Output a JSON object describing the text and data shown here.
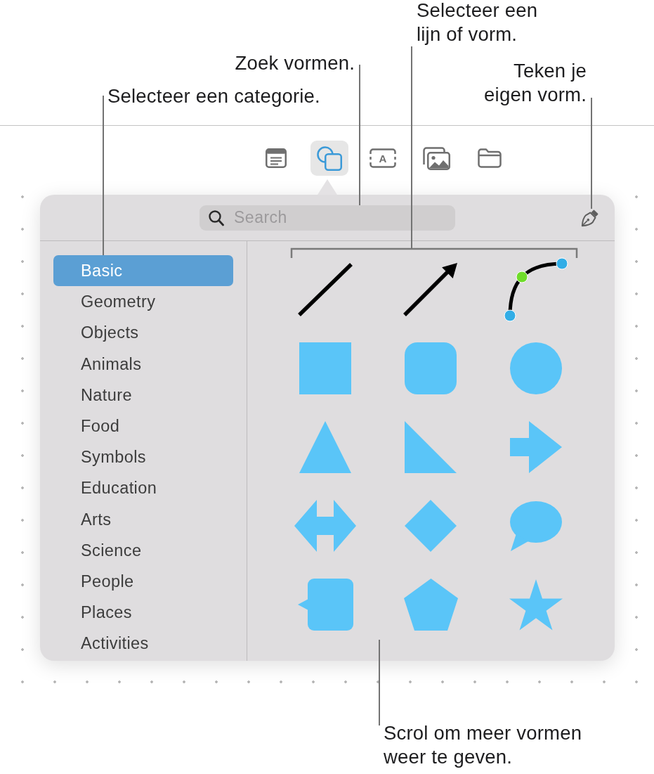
{
  "callouts": [
    {
      "text": "Selecteer een lijn of vorm."
    },
    {
      "text": "Zoek vormen."
    },
    {
      "text": "Selecteer een categorie."
    },
    {
      "text": "Teken je eigen vorm."
    },
    {
      "text": "Scrol om meer vormen weer te geven."
    }
  ],
  "toolbar": {
    "items": [
      {
        "kind": "notes",
        "selected": false
      },
      {
        "kind": "shapes",
        "selected": true
      },
      {
        "kind": "textbox",
        "label": "A",
        "selected": false
      },
      {
        "kind": "media",
        "selected": false
      },
      {
        "kind": "folder",
        "selected": false
      }
    ]
  },
  "shapes_popover": {
    "search": {
      "placeholder": "Search"
    },
    "categories": [
      {
        "label": "Basic",
        "selected": true
      },
      {
        "label": "Geometry",
        "selected": false
      },
      {
        "label": "Objects",
        "selected": false
      },
      {
        "label": "Animals",
        "selected": false
      },
      {
        "label": "Nature",
        "selected": false
      },
      {
        "label": "Food",
        "selected": false
      },
      {
        "label": "Symbols",
        "selected": false
      },
      {
        "label": "Education",
        "selected": false
      },
      {
        "label": "Arts",
        "selected": false
      },
      {
        "label": "Science",
        "selected": false
      },
      {
        "label": "People",
        "selected": false
      },
      {
        "label": "Places",
        "selected": false
      },
      {
        "label": "Activities",
        "selected": false
      }
    ],
    "shapes": [
      {
        "kind": "line"
      },
      {
        "kind": "arrow"
      },
      {
        "kind": "curve"
      },
      {
        "kind": "square"
      },
      {
        "kind": "rounded-square"
      },
      {
        "kind": "circle"
      },
      {
        "kind": "triangle"
      },
      {
        "kind": "right-triangle"
      },
      {
        "kind": "arrow-right"
      },
      {
        "kind": "double-arrow"
      },
      {
        "kind": "diamond"
      },
      {
        "kind": "speech-bubble"
      },
      {
        "kind": "callout-square"
      },
      {
        "kind": "pentagon"
      },
      {
        "kind": "star"
      }
    ]
  }
}
